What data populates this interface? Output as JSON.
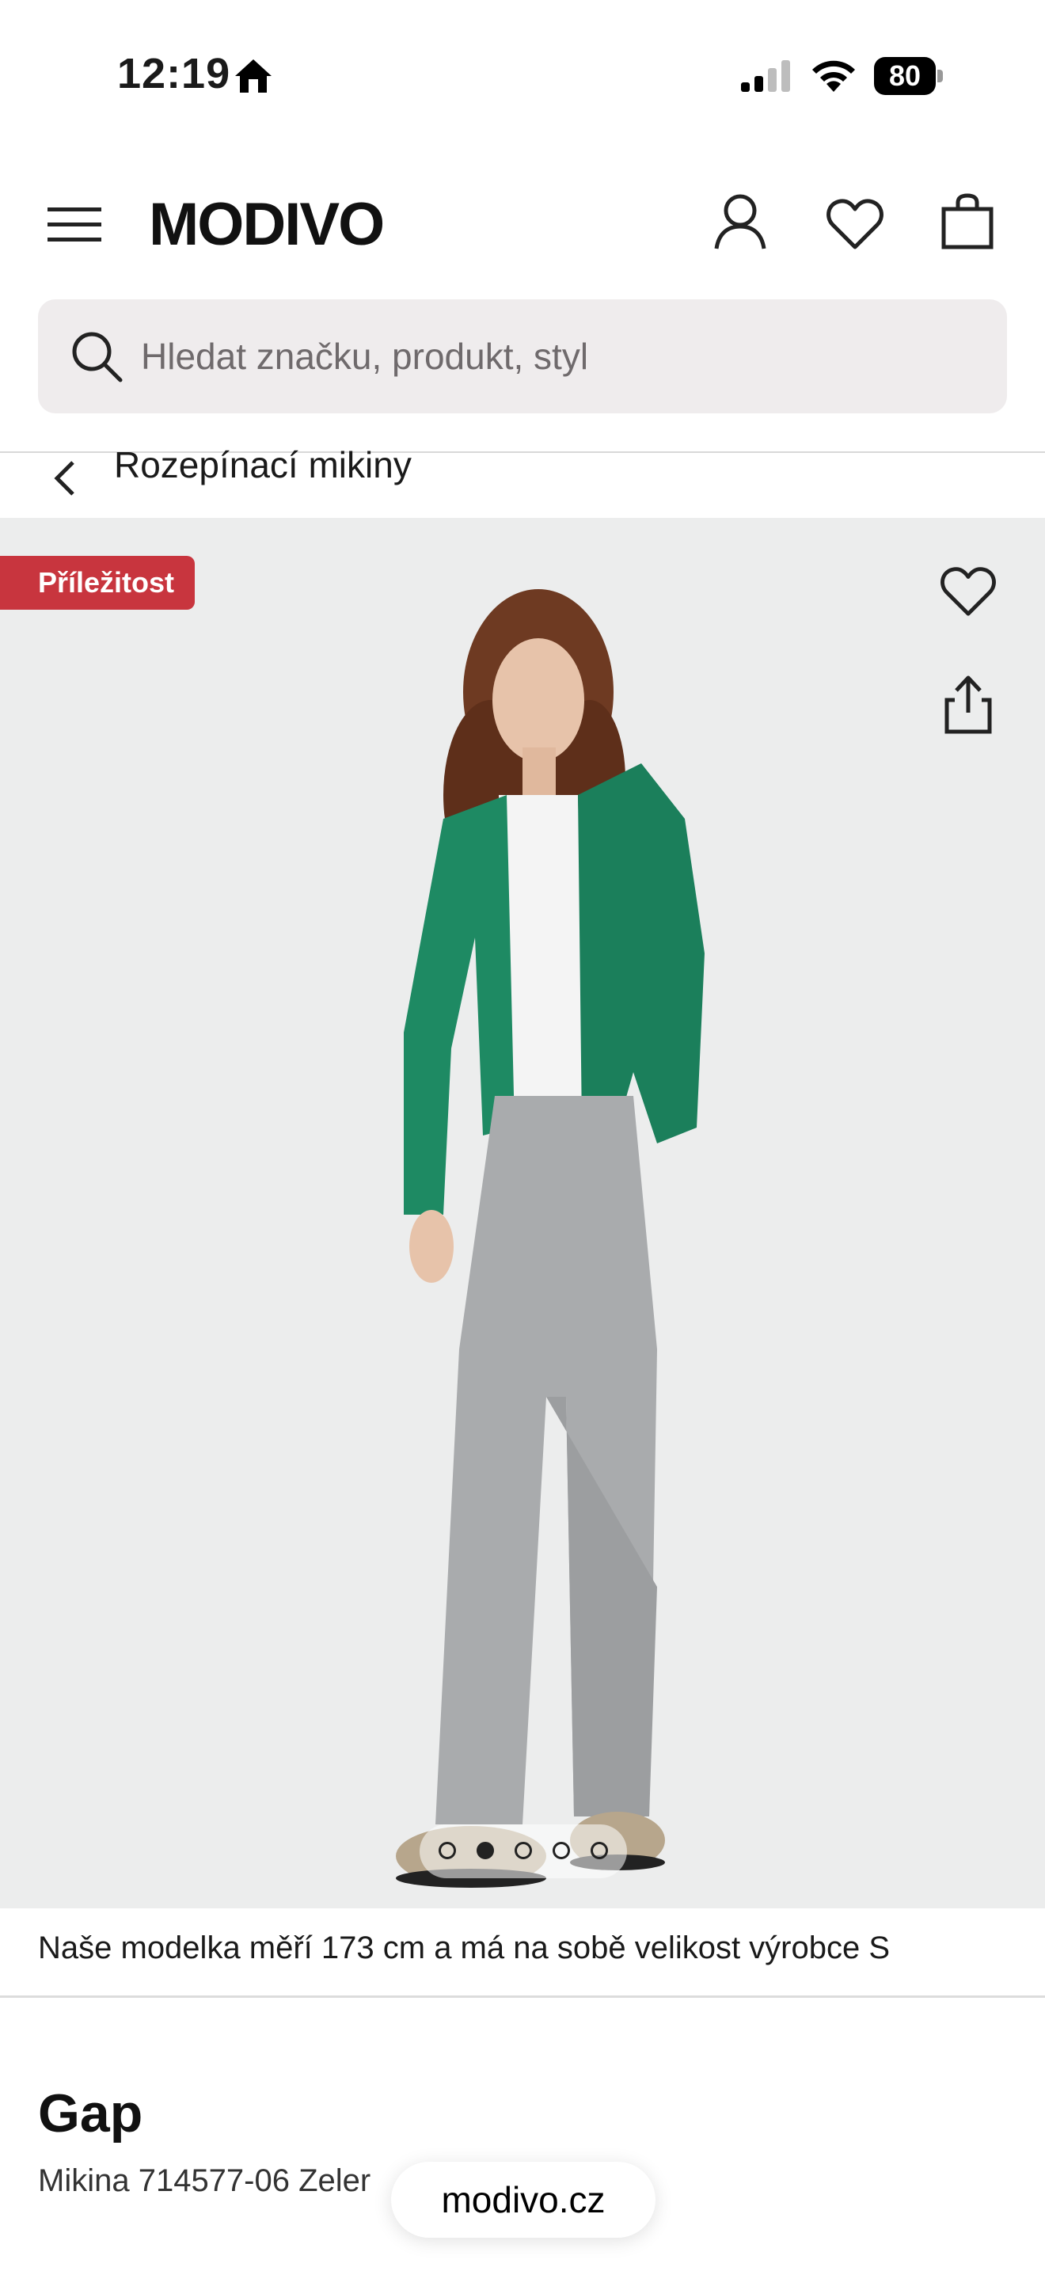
{
  "status_bar": {
    "time": "12:19",
    "battery": "80"
  },
  "header": {
    "logo": "MODIVO"
  },
  "search": {
    "placeholder": "Hledat značku, produkt, styl"
  },
  "breadcrumb": {
    "label": "Rozepínací mikiny"
  },
  "gallery": {
    "badge": "Příležitost",
    "badge_color": "#c8353e",
    "dots_total": 5,
    "dots_active_index": 1
  },
  "model_note": "Naše modelka měří 173 cm a má na sobě velikost výrobce S",
  "product": {
    "brand": "Gap",
    "name": "Mikina 714577-06 Zeler"
  },
  "browser": {
    "url": "modivo.cz"
  },
  "colors": {
    "accent": "#c8353e",
    "search_bg": "#efeced",
    "image_bg": "#eceded"
  }
}
